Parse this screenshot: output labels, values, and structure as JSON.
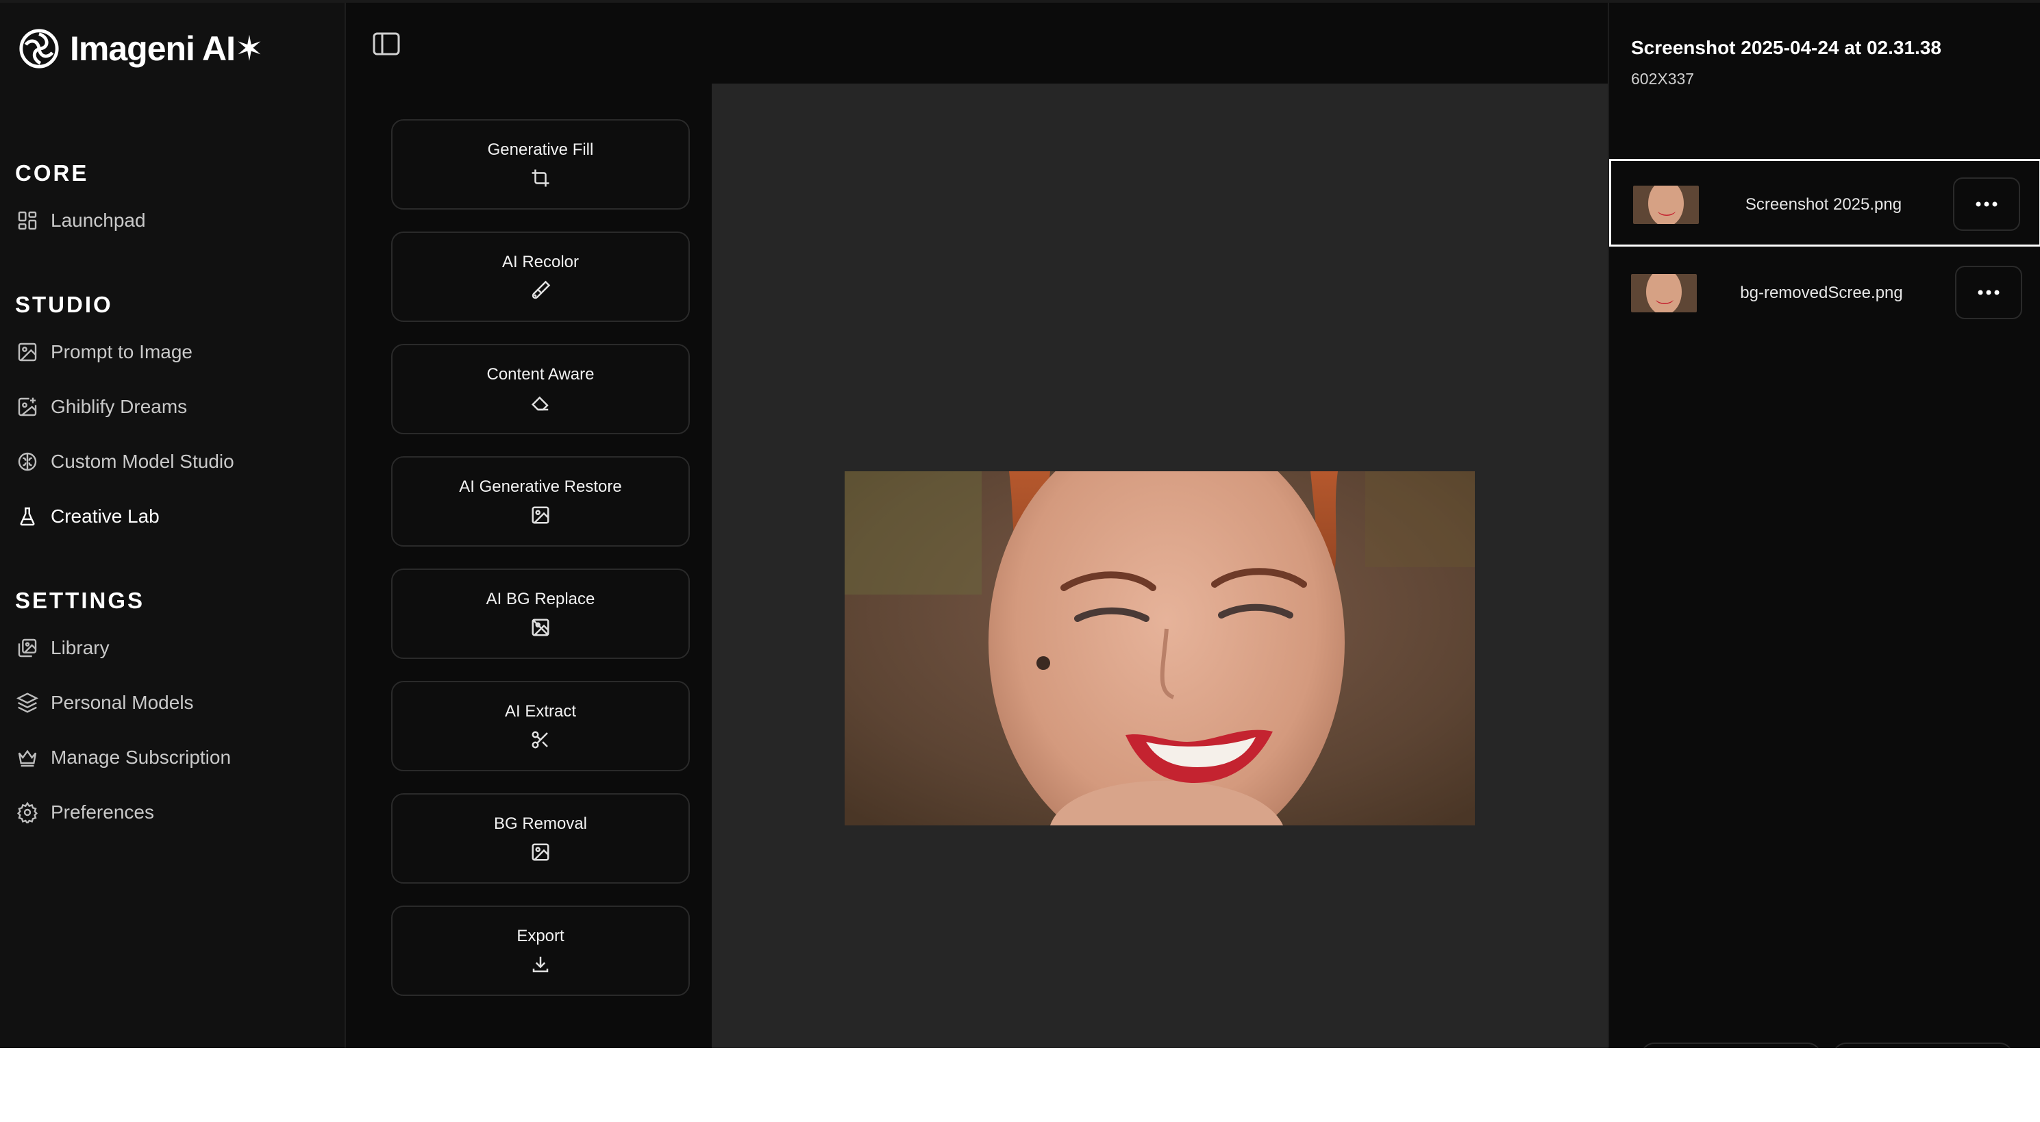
{
  "app": {
    "brand": "Imageni AI✶"
  },
  "sidebar": {
    "sections": [
      {
        "title": "CORE",
        "items": [
          {
            "label": "Launchpad",
            "icon": "grid-icon"
          }
        ]
      },
      {
        "title": "STUDIO",
        "items": [
          {
            "label": "Prompt to Image",
            "icon": "image-icon"
          },
          {
            "label": "Ghiblify Dreams",
            "icon": "image-sparkle-icon"
          },
          {
            "label": "Custom Model Studio",
            "icon": "brain-icon"
          },
          {
            "label": "Creative Lab",
            "icon": "flask-icon",
            "active": true
          }
        ]
      },
      {
        "title": "SETTINGS",
        "items": [
          {
            "label": "Library",
            "icon": "library-icon"
          },
          {
            "label": "Personal Models",
            "icon": "layers-icon"
          },
          {
            "label": "Manage Subscription",
            "icon": "crown-icon"
          },
          {
            "label": "Preferences",
            "icon": "gear-icon"
          }
        ]
      }
    ]
  },
  "tools": [
    {
      "label": "Generative Fill",
      "icon": "crop-icon"
    },
    {
      "label": "AI Recolor",
      "icon": "brush-icon"
    },
    {
      "label": "Content Aware",
      "icon": "eraser-icon"
    },
    {
      "label": "AI Generative Restore",
      "icon": "image-icon"
    },
    {
      "label": "AI BG Replace",
      "icon": "image-off-icon"
    },
    {
      "label": "AI Extract",
      "icon": "scissors-icon"
    },
    {
      "label": "BG Removal",
      "icon": "image-icon"
    },
    {
      "label": "Export",
      "icon": "download-icon"
    }
  ],
  "file": {
    "title": "Screenshot 2025-04-24 at 02.31.38",
    "dimensions": "602X337"
  },
  "layers": [
    {
      "name": "Screenshot 2025.png",
      "selected": true
    },
    {
      "name": "bg-removedScree.png",
      "selected": false
    }
  ],
  "colors": {
    "background": "#0b0b0b",
    "sidebar": "#111111",
    "canvas": "#262626",
    "border": "#2a2a2a",
    "text": "#ffffff"
  }
}
